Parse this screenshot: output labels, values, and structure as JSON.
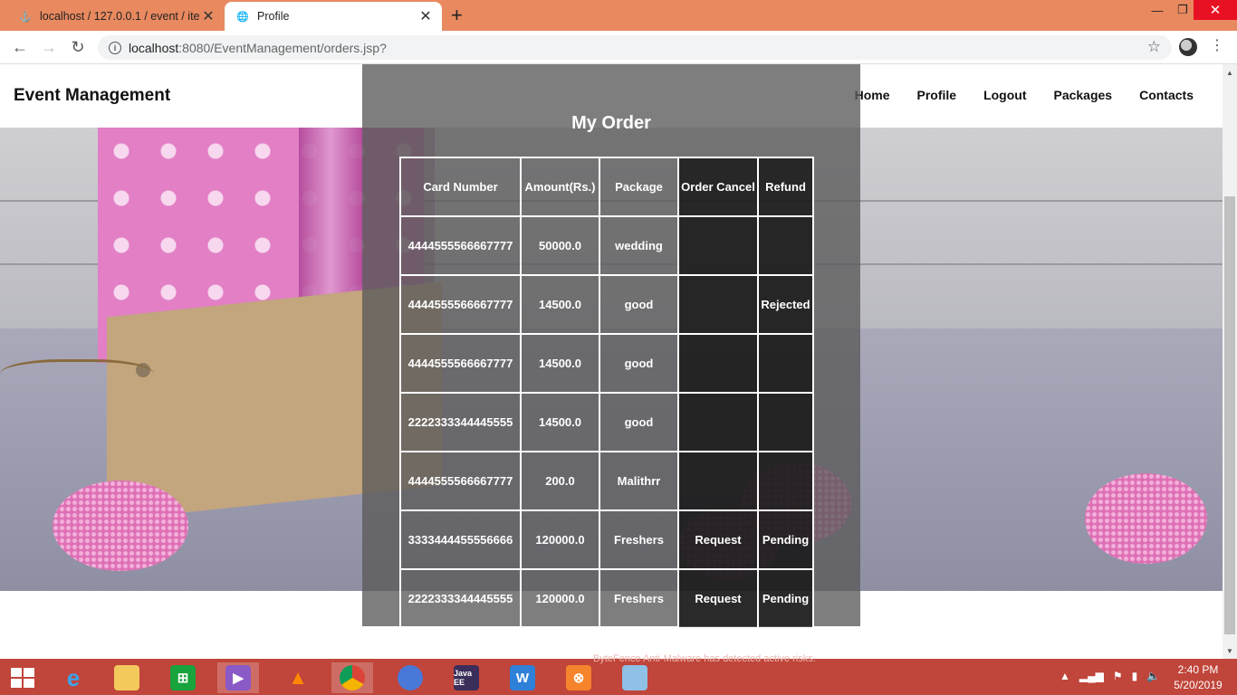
{
  "browser": {
    "tabs": [
      {
        "title": "localhost / 127.0.0.1 / event / ite",
        "icon": "phpmyadmin-icon",
        "active": false
      },
      {
        "title": "Profile",
        "icon": "globe-icon",
        "active": true
      }
    ],
    "url_host": "localhost",
    "url_rest": ":8080/EventManagement/orders.jsp?"
  },
  "site": {
    "brand": "Event Management",
    "nav": [
      "Home",
      "Profile",
      "Logout",
      "Packages",
      "Contacts"
    ]
  },
  "orders": {
    "title": "My Order",
    "columns": [
      "Card Number",
      "Amount(Rs.)",
      "Package",
      "Order Cancel",
      "Refund"
    ],
    "rows": [
      [
        "4444555566667777",
        "50000.0",
        "wedding",
        "",
        ""
      ],
      [
        "4444555566667777",
        "14500.0",
        "good",
        "",
        "Rejected"
      ],
      [
        "4444555566667777",
        "14500.0",
        "good",
        "",
        ""
      ],
      [
        "2222333344445555",
        "14500.0",
        "good",
        "",
        ""
      ],
      [
        "4444555566667777",
        "200.0",
        "Malithrr",
        "",
        ""
      ],
      [
        "3333444455556666",
        "120000.0",
        "Freshers",
        "Request",
        "Pending"
      ],
      [
        "2222333344445555",
        "120000.0",
        "Freshers",
        "Request",
        "Pending"
      ]
    ]
  },
  "taskbar": {
    "notification": "ByteFence Anti-Malware has detected active risks.",
    "time": "2:40 PM",
    "date": "5/20/2019",
    "apps": [
      "internet-explorer-icon",
      "file-explorer-icon",
      "store-icon",
      "visual-studio-icon",
      "vlc-icon",
      "chrome-icon",
      "chrome-alt-icon",
      "java-ee-ide-icon",
      "w-app-icon",
      "xampp-icon",
      "notepad-icon"
    ]
  }
}
